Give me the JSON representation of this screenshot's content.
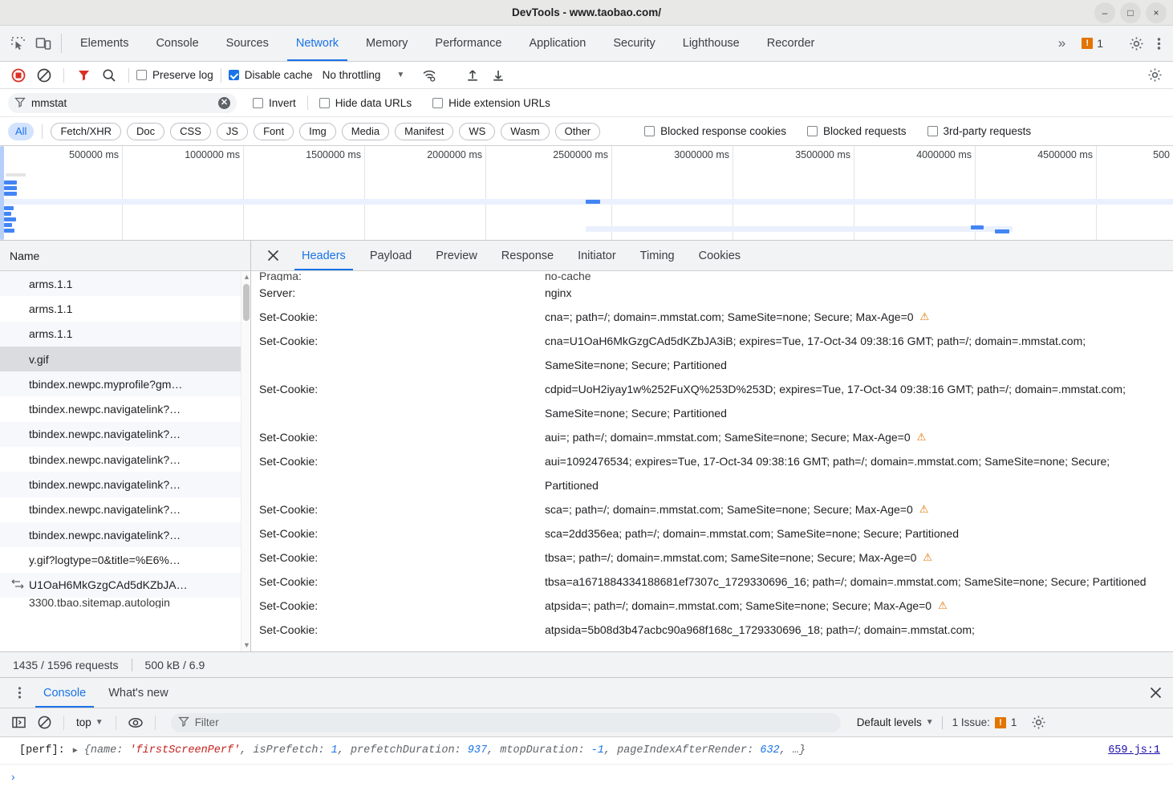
{
  "window": {
    "title": "DevTools - www.taobao.com/",
    "controls": {
      "minimize": "–",
      "maximize": "□",
      "close": "×"
    }
  },
  "main_tabs": {
    "inspect_icon": "inspect-element-icon",
    "device_icon": "device-toolbar-icon",
    "items": [
      {
        "label": "Elements",
        "active": false
      },
      {
        "label": "Console",
        "active": false
      },
      {
        "label": "Sources",
        "active": false
      },
      {
        "label": "Network",
        "active": true
      },
      {
        "label": "Memory",
        "active": false
      },
      {
        "label": "Performance",
        "active": false
      },
      {
        "label": "Application",
        "active": false
      },
      {
        "label": "Security",
        "active": false
      },
      {
        "label": "Lighthouse",
        "active": false
      },
      {
        "label": "Recorder",
        "active": false
      }
    ],
    "more": "»",
    "issues_count": "1",
    "issues_badge": "!",
    "settings_icon": "gear-icon",
    "menu_icon": "kebab-menu-icon"
  },
  "network_toolbar": {
    "record_icon": "record-stop-icon",
    "clear_icon": "clear-icon",
    "filter_icon": "filter-funnel-icon",
    "search_icon": "search-icon",
    "preserve_log": {
      "label": "Preserve log",
      "checked": false
    },
    "disable_cache": {
      "label": "Disable cache",
      "checked": true
    },
    "throttling": "No throttling",
    "throttling_arrow": "▼",
    "wifi_icon": "network-conditions-icon",
    "import_icon": "import-har-icon",
    "export_icon": "export-har-icon",
    "settings_icon": "network-settings-gear-icon"
  },
  "filter_row": {
    "funnel_icon": "filter-funnel-icon",
    "value": "mmstat",
    "placeholder": "Filter",
    "clear": "✕",
    "invert": {
      "label": "Invert",
      "checked": false
    },
    "hide_data_urls": {
      "label": "Hide data URLs",
      "checked": false
    },
    "hide_extension_urls": {
      "label": "Hide extension URLs",
      "checked": false
    }
  },
  "type_filters": {
    "pills": [
      "All",
      "Fetch/XHR",
      "Doc",
      "CSS",
      "JS",
      "Font",
      "Img",
      "Media",
      "Manifest",
      "WS",
      "Wasm",
      "Other"
    ],
    "active": "All",
    "checkboxes": [
      {
        "label": "Blocked response cookies",
        "checked": false
      },
      {
        "label": "Blocked requests",
        "checked": false
      },
      {
        "label": "3rd-party requests",
        "checked": false
      }
    ]
  },
  "overview": {
    "ticks": [
      "500000 ms",
      "1000000 ms",
      "1500000 ms",
      "2000000 ms",
      "2500000 ms",
      "3000000 ms",
      "3500000 ms",
      "4000000 ms",
      "4500000 ms",
      "500"
    ]
  },
  "request_list": {
    "column_header": "Name",
    "rows": [
      {
        "name": "arms.1.1",
        "selected": false,
        "icon": ""
      },
      {
        "name": "arms.1.1",
        "selected": false,
        "icon": ""
      },
      {
        "name": "arms.1.1",
        "selected": false,
        "icon": ""
      },
      {
        "name": "v.gif",
        "selected": true,
        "icon": ""
      },
      {
        "name": "tbindex.newpc.myprofile?gm…",
        "selected": false,
        "icon": ""
      },
      {
        "name": "tbindex.newpc.navigatelink?…",
        "selected": false,
        "icon": ""
      },
      {
        "name": "tbindex.newpc.navigatelink?…",
        "selected": false,
        "icon": ""
      },
      {
        "name": "tbindex.newpc.navigatelink?…",
        "selected": false,
        "icon": ""
      },
      {
        "name": "tbindex.newpc.navigatelink?…",
        "selected": false,
        "icon": ""
      },
      {
        "name": "tbindex.newpc.navigatelink?…",
        "selected": false,
        "icon": ""
      },
      {
        "name": "tbindex.newpc.navigatelink?…",
        "selected": false,
        "icon": ""
      },
      {
        "name": "y.gif?logtype=0&title=%E6%…",
        "selected": false,
        "icon": ""
      },
      {
        "name": "U1OaH6MkGzgCAd5dKZbJA…",
        "selected": false,
        "icon": "websocket-icon"
      },
      {
        "name": "3300.tbao.sitemap.autologin",
        "selected": false,
        "icon": ""
      }
    ]
  },
  "details": {
    "close_icon": "close-icon",
    "tabs": [
      {
        "label": "Headers",
        "active": true
      },
      {
        "label": "Payload",
        "active": false
      },
      {
        "label": "Preview",
        "active": false
      },
      {
        "label": "Response",
        "active": false
      },
      {
        "label": "Initiator",
        "active": false
      },
      {
        "label": "Timing",
        "active": false
      },
      {
        "label": "Cookies",
        "active": false
      }
    ],
    "headers": [
      {
        "name": "Pragma:",
        "value": "no-cache",
        "warn": false,
        "clipped": true
      },
      {
        "name": "Server:",
        "value": "nginx",
        "warn": false
      },
      {
        "name": "Set-Cookie:",
        "value": "cna=; path=/; domain=.mmstat.com; SameSite=none; Secure; Max-Age=0",
        "warn": true
      },
      {
        "name": "Set-Cookie:",
        "value": "cna=U1OaH6MkGzgCAd5dKZbJA3iB; expires=Tue, 17-Oct-34 09:38:16 GMT; path=/; domain=.mmstat.com; SameSite=none; Secure; Partitioned",
        "warn": false
      },
      {
        "name": "Set-Cookie:",
        "value": "cdpid=UoH2iyay1w%252FuXQ%253D%253D; expires=Tue, 17-Oct-34 09:38:16 GMT; path=/; domain=.mmstat.com; SameSite=none; Secure; Partitioned",
        "warn": false
      },
      {
        "name": "Set-Cookie:",
        "value": "aui=; path=/; domain=.mmstat.com; SameSite=none; Secure; Max-Age=0",
        "warn": true
      },
      {
        "name": "Set-Cookie:",
        "value": "aui=1092476534; expires=Tue, 17-Oct-34 09:38:16 GMT; path=/; domain=.mmstat.com; SameSite=none; Secure; Partitioned",
        "warn": false
      },
      {
        "name": "Set-Cookie:",
        "value": "sca=; path=/; domain=.mmstat.com; SameSite=none; Secure; Max-Age=0",
        "warn": true
      },
      {
        "name": "Set-Cookie:",
        "value": "sca=2dd356ea; path=/; domain=.mmstat.com; SameSite=none; Secure; Partitioned",
        "warn": false
      },
      {
        "name": "Set-Cookie:",
        "value": "tbsa=; path=/; domain=.mmstat.com; SameSite=none; Secure; Max-Age=0",
        "warn": true
      },
      {
        "name": "Set-Cookie:",
        "value": "tbsa=a1671884334188681ef7307c_1729330696_16; path=/; domain=.mmstat.com; SameSite=none; Secure; Partitioned",
        "warn": false
      },
      {
        "name": "Set-Cookie:",
        "value": "atpsida=; path=/; domain=.mmstat.com; SameSite=none; Secure; Max-Age=0",
        "warn": true
      },
      {
        "name": "Set-Cookie:",
        "value": "atpsida=5b08d3b47acbc90a968f168c_1729330696_18; path=/; domain=.mmstat.com;",
        "warn": false
      }
    ]
  },
  "status_bar": {
    "requests": "1435 / 1596 requests",
    "transferred": "500 kB / 6.9"
  },
  "drawer": {
    "kebab_icon": "kebab-menu-icon",
    "tabs": [
      {
        "label": "Console",
        "active": true
      },
      {
        "label": "What's new",
        "active": false
      }
    ],
    "close_icon": "close-icon",
    "toolbar": {
      "sidebar_icon": "console-sidebar-icon",
      "clear_icon": "clear-console-icon",
      "context": "top",
      "context_arrow": "▼",
      "eye_icon": "live-expression-icon",
      "filter_icon": "filter-funnel-icon",
      "filter_placeholder": "Filter",
      "levels": "Default levels",
      "levels_arrow": "▼",
      "issues_label": "1 Issue:",
      "issues_badge": "!",
      "issues_count": "1",
      "settings_icon": "gear-icon"
    },
    "log": {
      "label": "[perf]:",
      "triangle": "▶",
      "open_brace": "{",
      "entries": [
        {
          "key": "name: ",
          "value": "'firstScreenPerf'",
          "kind": "string"
        },
        {
          "key": "isPrefetch: ",
          "value": "1",
          "kind": "number"
        },
        {
          "key": "prefetchDuration: ",
          "value": "937",
          "kind": "number"
        },
        {
          "key": "mtopDuration: ",
          "value": "-1",
          "kind": "number"
        },
        {
          "key": "pageIndexAfterRender: ",
          "value": "632",
          "kind": "number"
        }
      ],
      "ellipsis": ", …}",
      "source": "659.js:1"
    },
    "prompt": "›"
  }
}
